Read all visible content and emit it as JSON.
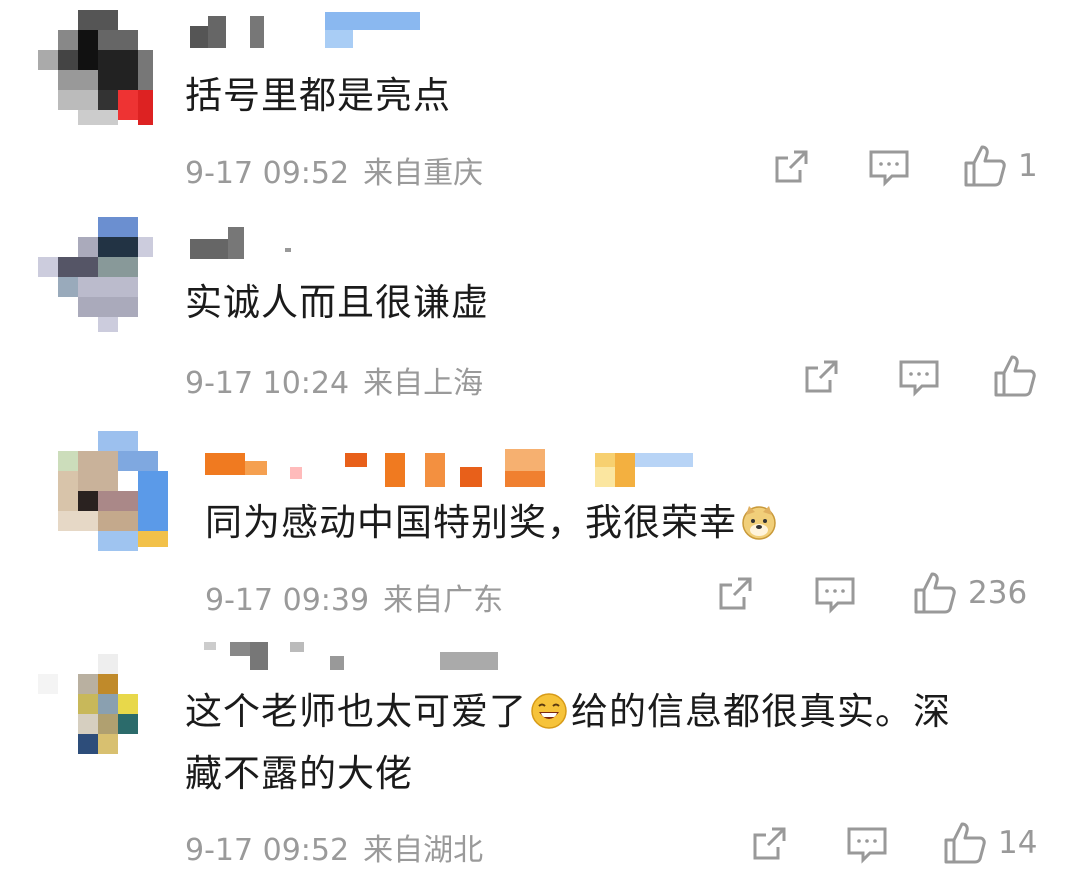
{
  "comments": [
    {
      "text": "括号里都是亮点",
      "text_line2": "",
      "time": "9-17 09:52",
      "location": "来自重庆",
      "likes": "1"
    },
    {
      "text": "实诚人而且很谦虚",
      "text_line2": "",
      "time": "9-17 10:24",
      "location": "来自上海",
      "likes": ""
    },
    {
      "text": "同为感动中国特别奖，我很荣幸",
      "text_line2": "",
      "time": "9-17 09:39",
      "location": "来自广东",
      "likes": "236"
    },
    {
      "text_part1": "这个老师也太可爱了",
      "text_part2": "给的信息都很真实。深",
      "text_line2": "藏不露的大佬",
      "time": "9-17 09:52",
      "location": "来自湖北",
      "likes": "14"
    }
  ],
  "icons": {
    "share": "share-icon",
    "reply": "comment-icon",
    "like": "thumbs-up-icon",
    "emoji_dog": "doge-emoji-icon",
    "emoji_laugh": "laughing-emoji-icon"
  },
  "colors": {
    "text": "#1b1b1b",
    "meta": "#9a9a9a",
    "background": "#ffffff"
  }
}
